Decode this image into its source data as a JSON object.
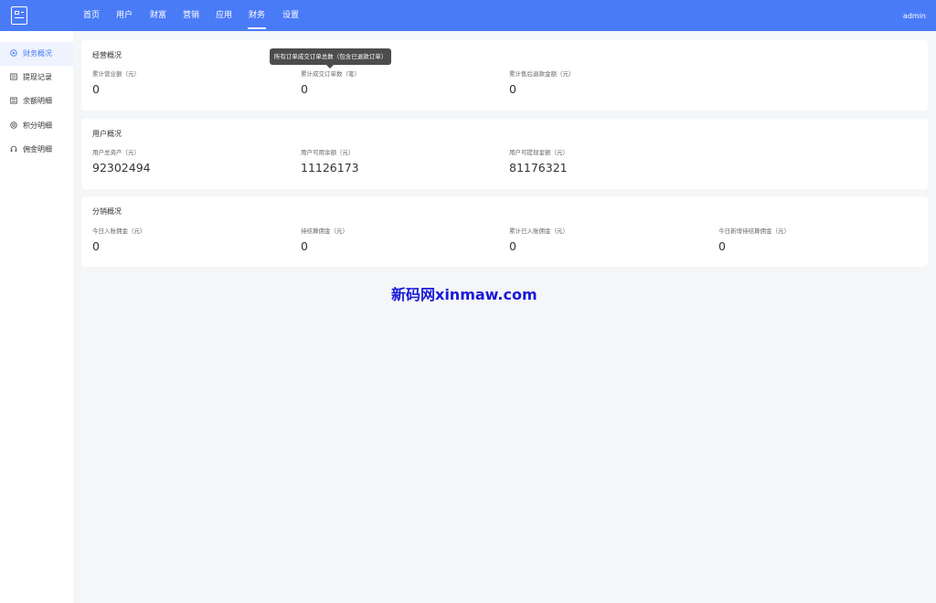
{
  "header": {
    "nav": [
      "首页",
      "用户",
      "财富",
      "营销",
      "应用",
      "财务",
      "设置"
    ],
    "active_nav": "财务",
    "user": "admin"
  },
  "sidebar": {
    "items": [
      {
        "label": "财务概况",
        "icon": "finance-overview-icon",
        "active": true
      },
      {
        "label": "提现记录",
        "icon": "withdraw-record-icon",
        "active": false
      },
      {
        "label": "余额明细",
        "icon": "balance-detail-icon",
        "active": false
      },
      {
        "label": "积分明细",
        "icon": "points-detail-icon",
        "active": false
      },
      {
        "label": "佣金明细",
        "icon": "commission-detail-icon",
        "active": false
      }
    ]
  },
  "cards": [
    {
      "title": "经营概况",
      "stats": [
        {
          "label": "累计营业额（元）",
          "value": "0"
        },
        {
          "label": "累计成交订单数（笔）",
          "value": "0"
        },
        {
          "label": "累计售后退款金额（元）",
          "value": "0"
        }
      ]
    },
    {
      "title": "用户概况",
      "stats": [
        {
          "label": "用户总资产（元）",
          "value": "92302494"
        },
        {
          "label": "用户可用余额（元）",
          "value": "11126173"
        },
        {
          "label": "用户可提现金额（元）",
          "value": "81176321"
        }
      ]
    },
    {
      "title": "分销概况",
      "stats": [
        {
          "label": "今日入账佣金（元）",
          "value": "0"
        },
        {
          "label": "待结算佣金（元）",
          "value": "0"
        },
        {
          "label": "累计已入账佣金（元）",
          "value": "0"
        },
        {
          "label": "今日新增待结算佣金（元）",
          "value": "0"
        }
      ]
    }
  ],
  "tooltip": "所有订单成交订单总数（包含已退款订单）",
  "watermark": "新码网xinmaw.com",
  "colors": {
    "primary": "#4a7bf7",
    "background": "#f5f6f8",
    "watermark": "#1a1ad6"
  }
}
